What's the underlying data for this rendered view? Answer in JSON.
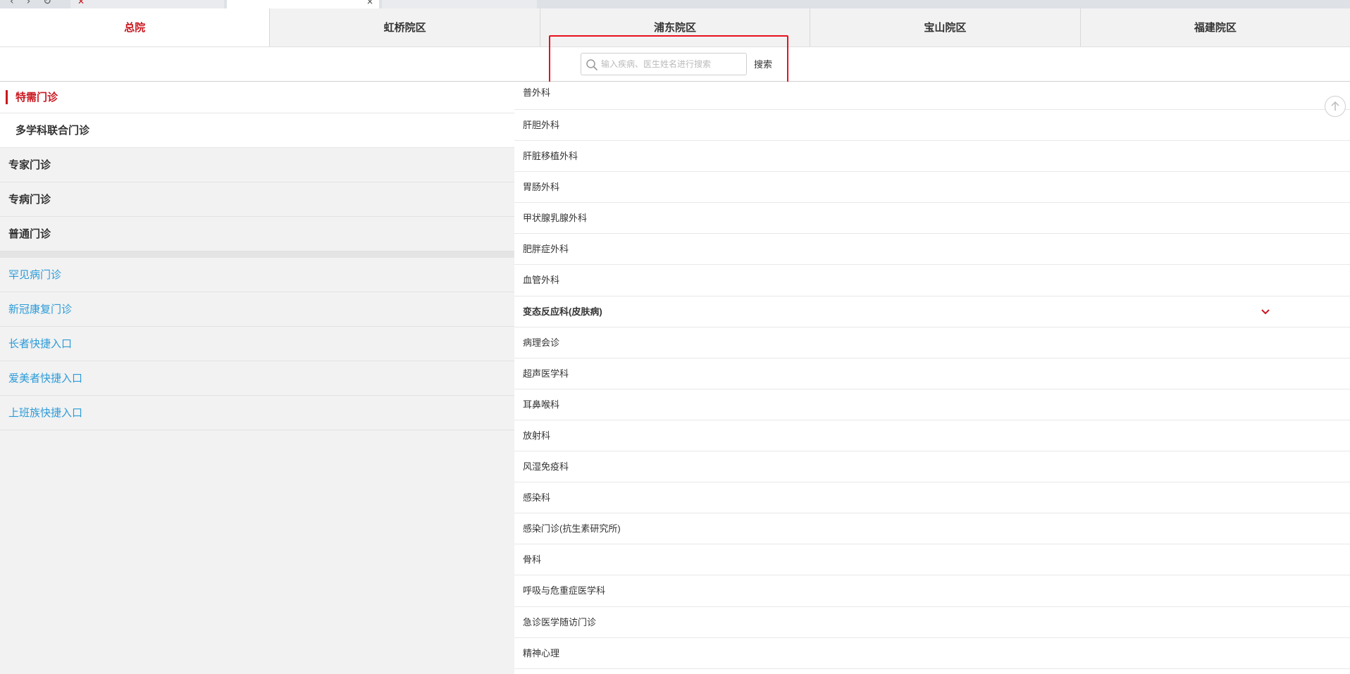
{
  "campus_tabs": [
    {
      "label": "总院"
    },
    {
      "label": "虹桥院区"
    },
    {
      "label": "浦东院区"
    },
    {
      "label": "宝山院区"
    },
    {
      "label": "福建院区"
    }
  ],
  "search": {
    "placeholder": "输入疾病、医生姓名进行搜索",
    "button_label": "搜索"
  },
  "sidebar": {
    "sub_items": [
      {
        "label": "特需门诊"
      },
      {
        "label": "多学科联合门诊"
      }
    ],
    "main_items": [
      {
        "label": "专家门诊"
      },
      {
        "label": "专病门诊"
      },
      {
        "label": "普通门诊"
      }
    ],
    "links": [
      {
        "label": "罕见病门诊"
      },
      {
        "label": "新冠康复门诊"
      },
      {
        "label": "长者快捷入口"
      },
      {
        "label": "爱美者快捷入口"
      },
      {
        "label": "上班族快捷入口"
      }
    ]
  },
  "departments": [
    {
      "label": "普外科"
    },
    {
      "label": "肝胆外科"
    },
    {
      "label": "肝脏移植外科"
    },
    {
      "label": "胃肠外科"
    },
    {
      "label": "甲状腺乳腺外科"
    },
    {
      "label": "肥胖症外科"
    },
    {
      "label": "血管外科"
    },
    {
      "label": "变态反应科(皮肤病)"
    },
    {
      "label": "病理会诊"
    },
    {
      "label": "超声医学科"
    },
    {
      "label": "耳鼻喉科"
    },
    {
      "label": "放射科"
    },
    {
      "label": "风湿免疫科"
    },
    {
      "label": "感染科"
    },
    {
      "label": "感染门诊(抗生素研究所)"
    },
    {
      "label": "骨科"
    },
    {
      "label": "呼吸与危重症医学科"
    },
    {
      "label": "急诊医学随访门诊"
    },
    {
      "label": "精神心理"
    }
  ],
  "colors": {
    "accent_red": "#c9171e",
    "link_blue": "#2b9bd8",
    "highlight_red": "#e8101e"
  }
}
